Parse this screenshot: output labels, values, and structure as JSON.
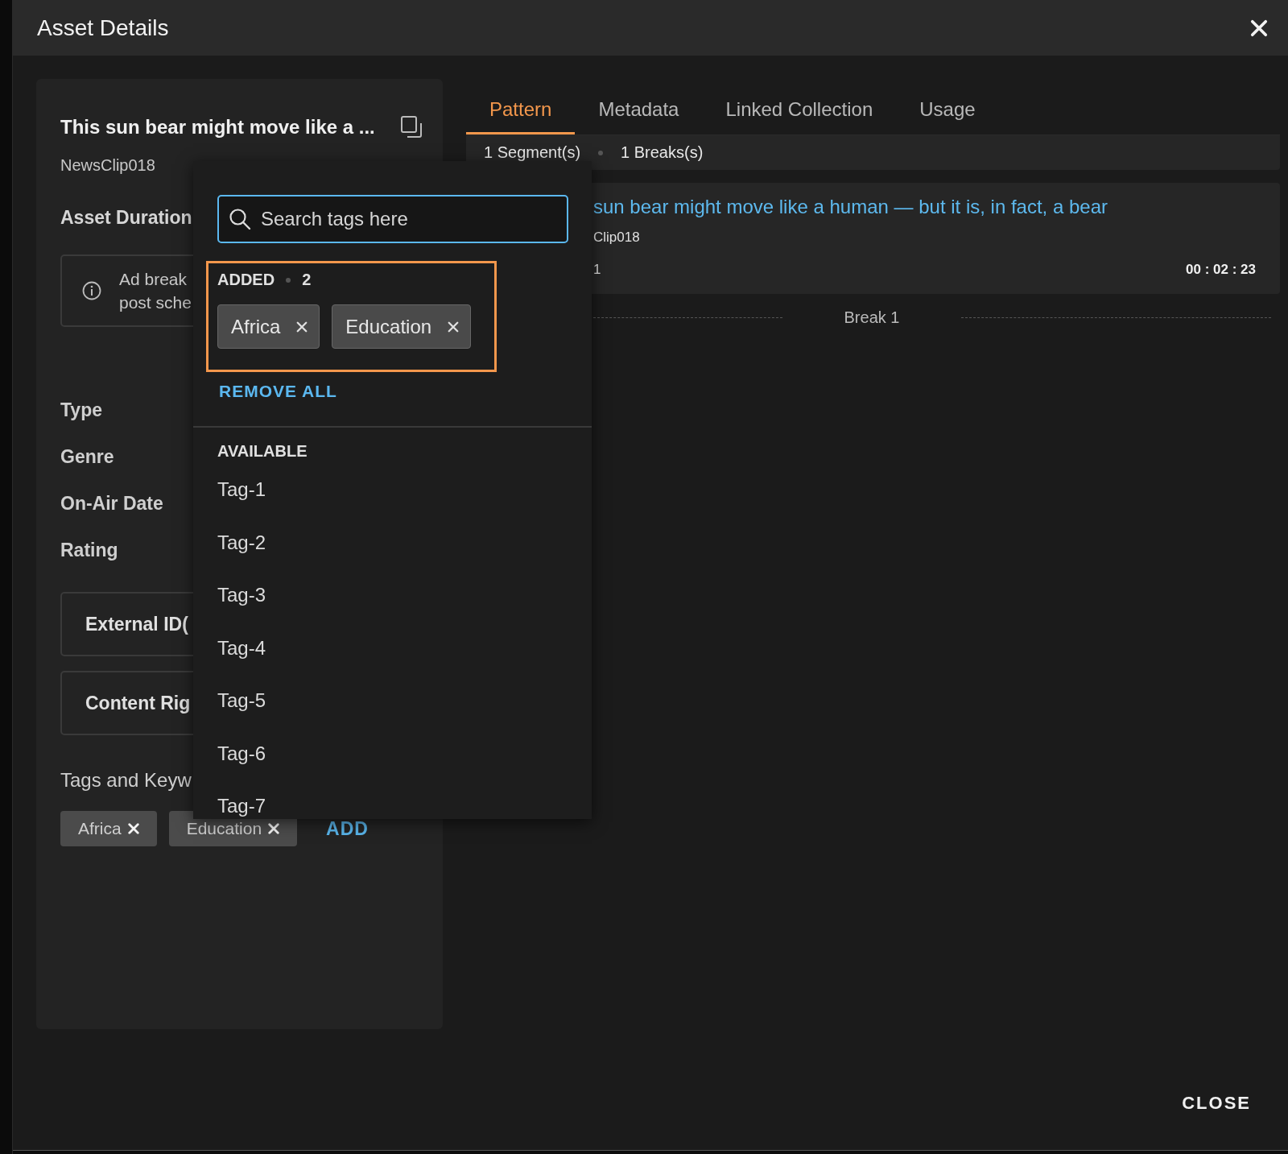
{
  "window": {
    "title": "Asset Details"
  },
  "asset_card": {
    "title": "This sun bear might move like a ...",
    "asset_id": "NewsClip018",
    "duration_label": "Asset Duration",
    "notice_lines": [
      "Ad break",
      "post sche"
    ],
    "fields": [
      "Type",
      "Genre",
      "On-Air Date",
      "Rating"
    ],
    "sections": [
      "External ID(",
      "Content Rig"
    ],
    "tags_label": "Tags and Keyw",
    "tags": [
      "Africa",
      "Education"
    ],
    "add_button": "ADD"
  },
  "tabs": [
    {
      "label": "Pattern",
      "selected": true
    },
    {
      "label": "Metadata",
      "selected": false
    },
    {
      "label": "Linked Collection",
      "selected": false
    },
    {
      "label": "Usage",
      "selected": false
    }
  ],
  "summary": {
    "segments": "1 Segment(s)",
    "breaks": "1 Breaks(s)"
  },
  "segment": {
    "title": "sun bear might move like a human — but it is, in fact, a bear",
    "asset_id": "Clip018",
    "number": "1",
    "duration": "00 : 02 : 23"
  },
  "break_label": "Break 1",
  "tag_picker": {
    "placeholder": "Search tags here",
    "added_label": "ADDED",
    "added_count": "2",
    "added": [
      "Africa",
      "Education"
    ],
    "remove_all": "REMOVE ALL",
    "available_label": "AVAILABLE",
    "available": [
      "Tag-1",
      "Tag-2",
      "Tag-3",
      "Tag-4",
      "Tag-5",
      "Tag-6",
      "Tag-7"
    ]
  },
  "footer": {
    "close": "CLOSE"
  }
}
